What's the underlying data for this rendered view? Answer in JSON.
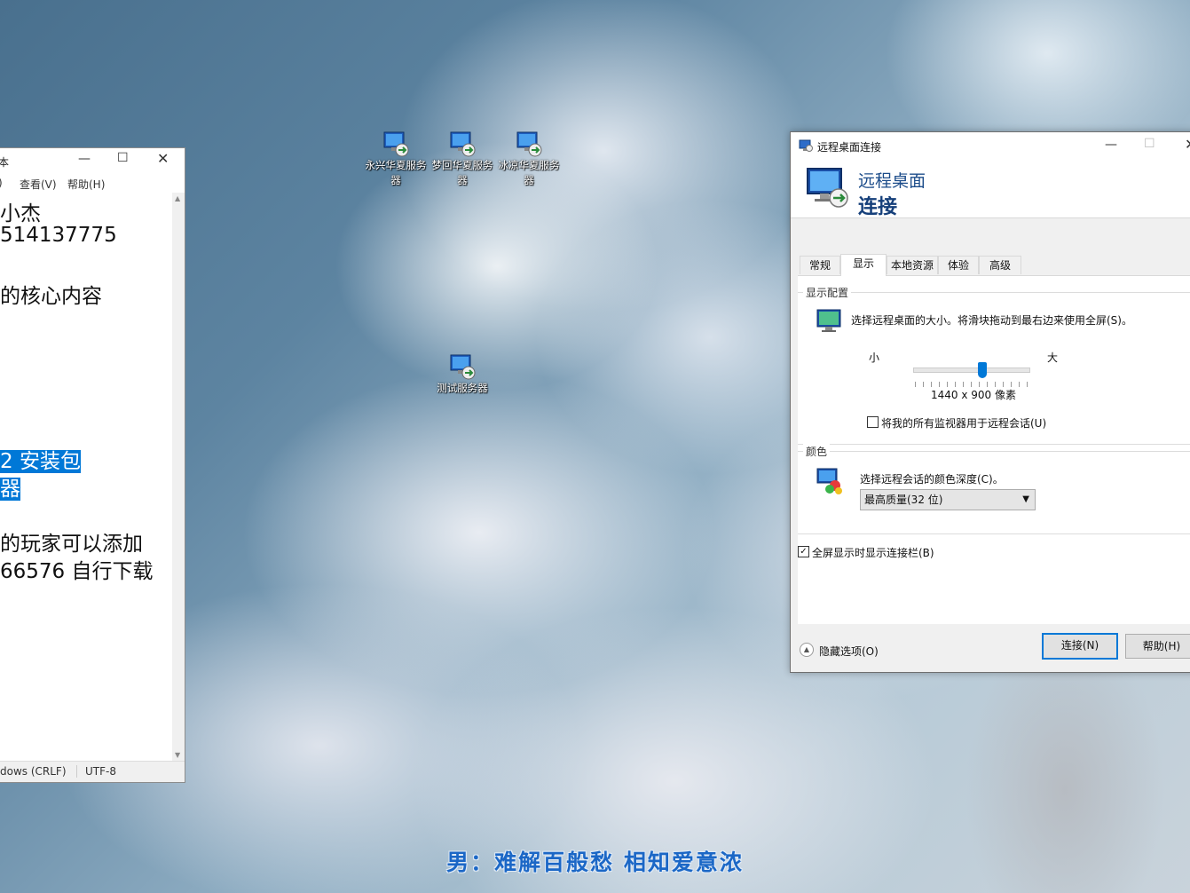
{
  "desktop": {
    "icons": [
      {
        "label": "永兴华夏服务器"
      },
      {
        "label": "梦回华夏服务器"
      },
      {
        "label": "冰凉华夏服务器"
      },
      {
        "label": "测试服务器"
      }
    ]
  },
  "notepad": {
    "title_fragment": "本",
    "menu": {
      "view": "查看(V)",
      "help": "帮助(H)",
      "partial": ")"
    },
    "lines": [
      "小杰",
      "514137775",
      "的核心内容",
      "2 安装包",
      "器",
      "的玩家可以添加",
      "66576 自行下载"
    ],
    "status": {
      "eol": "dows (CRLF)",
      "encoding": "UTF-8"
    }
  },
  "rdp": {
    "window_title": "远程桌面连接",
    "banner": {
      "line1": "远程桌面",
      "line2": "连接"
    },
    "tabs": [
      "常规",
      "显示",
      "本地资源",
      "体验",
      "高级"
    ],
    "display_group": {
      "label": "显示配置",
      "description": "选择远程桌面的大小。将滑块拖动到最右边来使用全屏(S)。",
      "small": "小",
      "large": "大",
      "resolution": "1440 x 900 像素",
      "slider_level": 0.6,
      "multi_monitor_label": "将我的所有监视器用于远程会话(U)",
      "multi_monitor_checked": false
    },
    "color_group": {
      "label": "颜色",
      "description": "选择远程会话的颜色深度(C)。",
      "selected": "最高质量(32 位)"
    },
    "connection_bar_label": "全屏显示时显示连接栏(B)",
    "connection_bar_checked": true,
    "hide_options": "隐藏选项(O)",
    "connect_button": "连接(N)",
    "help_button": "帮助(H)"
  },
  "subtitle": "男：难解百般愁  相知爱意浓",
  "colors": {
    "accent": "#0078d7",
    "subtitle": "#1b67c6",
    "banner": "#1c4c8a"
  }
}
